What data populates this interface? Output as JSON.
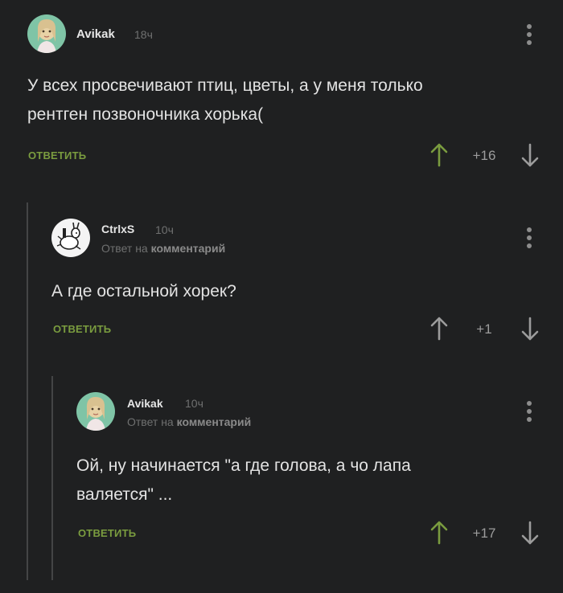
{
  "comments": [
    {
      "user": "Avikak",
      "time": "18ч",
      "reply_prefix": "",
      "reply_target": "",
      "text_lines": [
        "У всех просвечивают птиц, цветы, а у меня только",
        "рентген позвоночника хорька("
      ],
      "reply_label": "ОТВЕТИТЬ",
      "rating": "+16",
      "upvote_color": "#7a9c3f"
    },
    {
      "user": "CtrlxS",
      "time": "10ч",
      "reply_prefix": "Ответ на",
      "reply_target": "комментарий",
      "text_lines": [
        "А где остальной хорек?"
      ],
      "reply_label": "ОТВЕТИТЬ",
      "rating": "+1",
      "upvote_color": "#9c9c9c"
    },
    {
      "user": "Avikak",
      "time": "10ч",
      "reply_prefix": "Ответ на",
      "reply_target": "комментарий",
      "text_lines": [
        "Ой, ну начинается \"а где голова, а чо лапа",
        "валяется\" ..."
      ],
      "reply_label": "ОТВЕТИТЬ",
      "rating": "+17",
      "upvote_color": "#7a9c3f"
    }
  ],
  "icons": {
    "upvote": "arrow-up-icon",
    "downvote": "arrow-down-icon",
    "menu": "more-vertical-icon"
  },
  "colors": {
    "background": "#1f2021",
    "accent": "#7a9c3f",
    "muted": "#6f7070"
  }
}
